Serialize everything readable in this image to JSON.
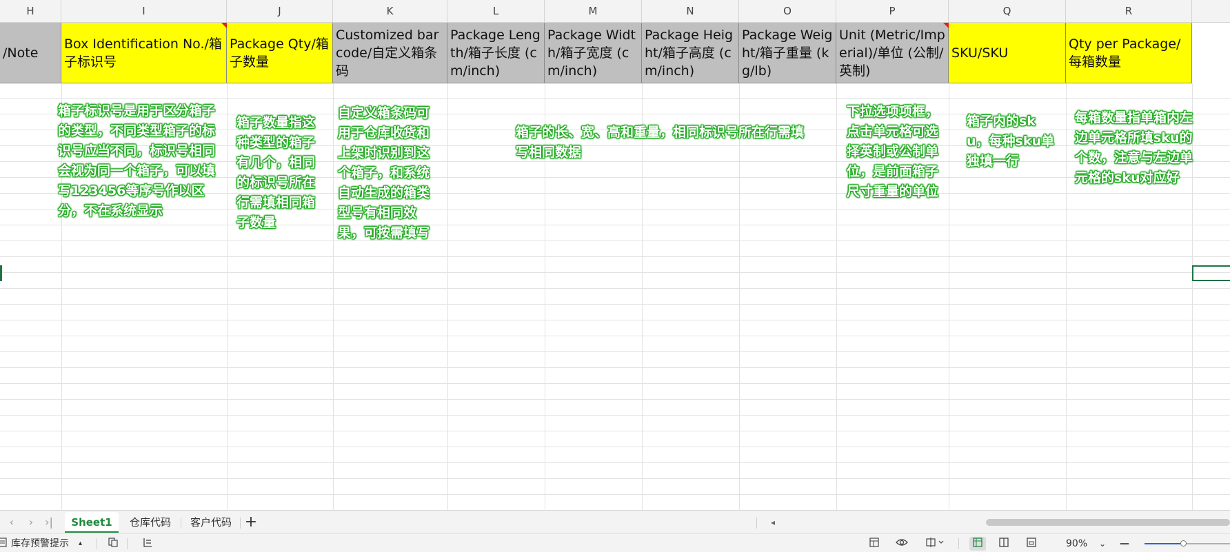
{
  "columns": [
    {
      "letter": "H",
      "header": "/Note"
    },
    {
      "letter": "I",
      "header": "Box Identification No./箱子标识号"
    },
    {
      "letter": "J",
      "header": "Package Qty/箱子数量"
    },
    {
      "letter": "K",
      "header": "Customized barcode/自定义箱条码"
    },
    {
      "letter": "L",
      "header": "Package Length/箱子长度 (cm/inch)"
    },
    {
      "letter": "M",
      "header": "Package Width/箱子宽度 (cm/inch)"
    },
    {
      "letter": "N",
      "header": "Package Height/箱子高度 (cm/inch)"
    },
    {
      "letter": "O",
      "header": "Package Weight/箱子重量 (kg/lb)"
    },
    {
      "letter": "P",
      "header": "Unit (Metric/Imperial)/单位 (公制/英制)"
    },
    {
      "letter": "Q",
      "header": "SKU/SKU"
    },
    {
      "letter": "R",
      "header": "Qty per Package/每箱数量"
    }
  ],
  "annotations": {
    "box_id": "箱子标识号是用于区分箱子的类型，不同类型箱子的标识号应当不同，标识号相同会视为同一个箱子，可以填写123456等序号作以区分，不在系统显示",
    "qty": "箱子数量指这种类型的箱子有几个，相同的标识号所在行需填相同箱子数量",
    "barcode": "自定义箱条码可用于仓库收货和上架时识别到这个箱子，和系统自动生成的箱类型号有相同效果，可按需填写",
    "dims": "箱子的长、宽、高和重量，相同标识号所在行需填写相同数据",
    "unit": "下拉选项项框，点击单元格可选择英制或公制单位，是前面箱子尺寸重量的单位",
    "sku": "箱子内的sku，每种sku单独填一行",
    "qty_per": "每箱数量指单箱内左边单元格所填sku的个数，注意与左边单元格的sku对应好"
  },
  "sheet_tabs": {
    "active": "Sheet1",
    "tab2": "仓库代码",
    "tab3": "客户代码",
    "add": "+"
  },
  "nav": {
    "first": "‹",
    "prev": "›",
    "last": "›|",
    "scroll_left": "◂"
  },
  "statusbar": {
    "left_label": "库存预警提示",
    "left_caret": "▴",
    "zoom": "90%",
    "zoom_caret": "⌄",
    "zoom_minus": "—",
    "zoom_level_fraction": 0.45
  },
  "icons": {
    "status_left": "doc-icon",
    "copy": "copy-icon",
    "outline": "outline-icon",
    "layout": "layout-icon",
    "eye": "eye-icon",
    "freeze": "freeze-icon",
    "normal_view": "normal-view-icon",
    "page_view": "page-view-icon",
    "page_break": "page-break-icon"
  },
  "colors": {
    "header_gray": "#bfbfbf",
    "header_yellow": "#ffff00",
    "annotation_green": "#1aa81a",
    "selection": "#217346"
  }
}
